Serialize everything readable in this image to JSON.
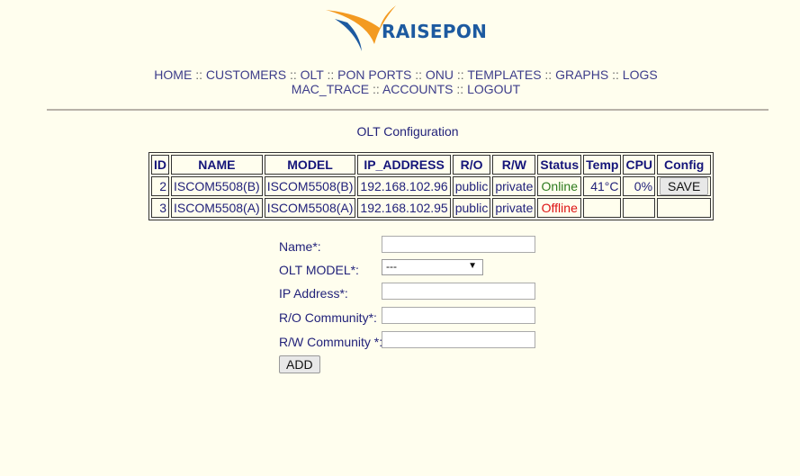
{
  "brand": {
    "name": "RAISEPON"
  },
  "nav": {
    "items": [
      "HOME",
      "CUSTOMERS",
      "OLT",
      "PON PORTS",
      "ONU",
      "TEMPLATES",
      "GRAPHS",
      "LOGS",
      "MAC_TRACE",
      "ACCOUNTS",
      "LOGOUT"
    ],
    "separator": "::"
  },
  "page": {
    "title": "OLT Configuration"
  },
  "table": {
    "headers": [
      "ID",
      "NAME",
      "MODEL",
      "IP_ADDRESS",
      "R/O",
      "R/W",
      "Status",
      "Temp",
      "CPU",
      "Config"
    ],
    "rows": [
      {
        "id": "2",
        "name": "ISCOM5508(B)",
        "model": "ISCOM5508(B)",
        "ip": "192.168.102.96",
        "ro": "public",
        "rw": "private",
        "status": "Online",
        "temp": "41°C",
        "cpu": "0%",
        "config": "SAVE"
      },
      {
        "id": "3",
        "name": "ISCOM5508(A)",
        "model": "ISCOM5508(A)",
        "ip": "192.168.102.95",
        "ro": "public",
        "rw": "private",
        "status": "Offline",
        "temp": "",
        "cpu": "",
        "config": ""
      }
    ]
  },
  "form": {
    "name_label": "Name*:",
    "model_label": "OLT MODEL*:",
    "model_selected": "---",
    "ip_label": "IP Address*:",
    "ro_label": "R/O Community*:",
    "rw_label": "R/W Community *:",
    "add_label": "ADD"
  },
  "colors": {
    "background": "#fffeee",
    "link": "#3d3d8a",
    "online": "#2c7a1c",
    "offline": "#dd1111",
    "logo_orange": "#f39a21",
    "logo_blue": "#1d5aa0"
  }
}
